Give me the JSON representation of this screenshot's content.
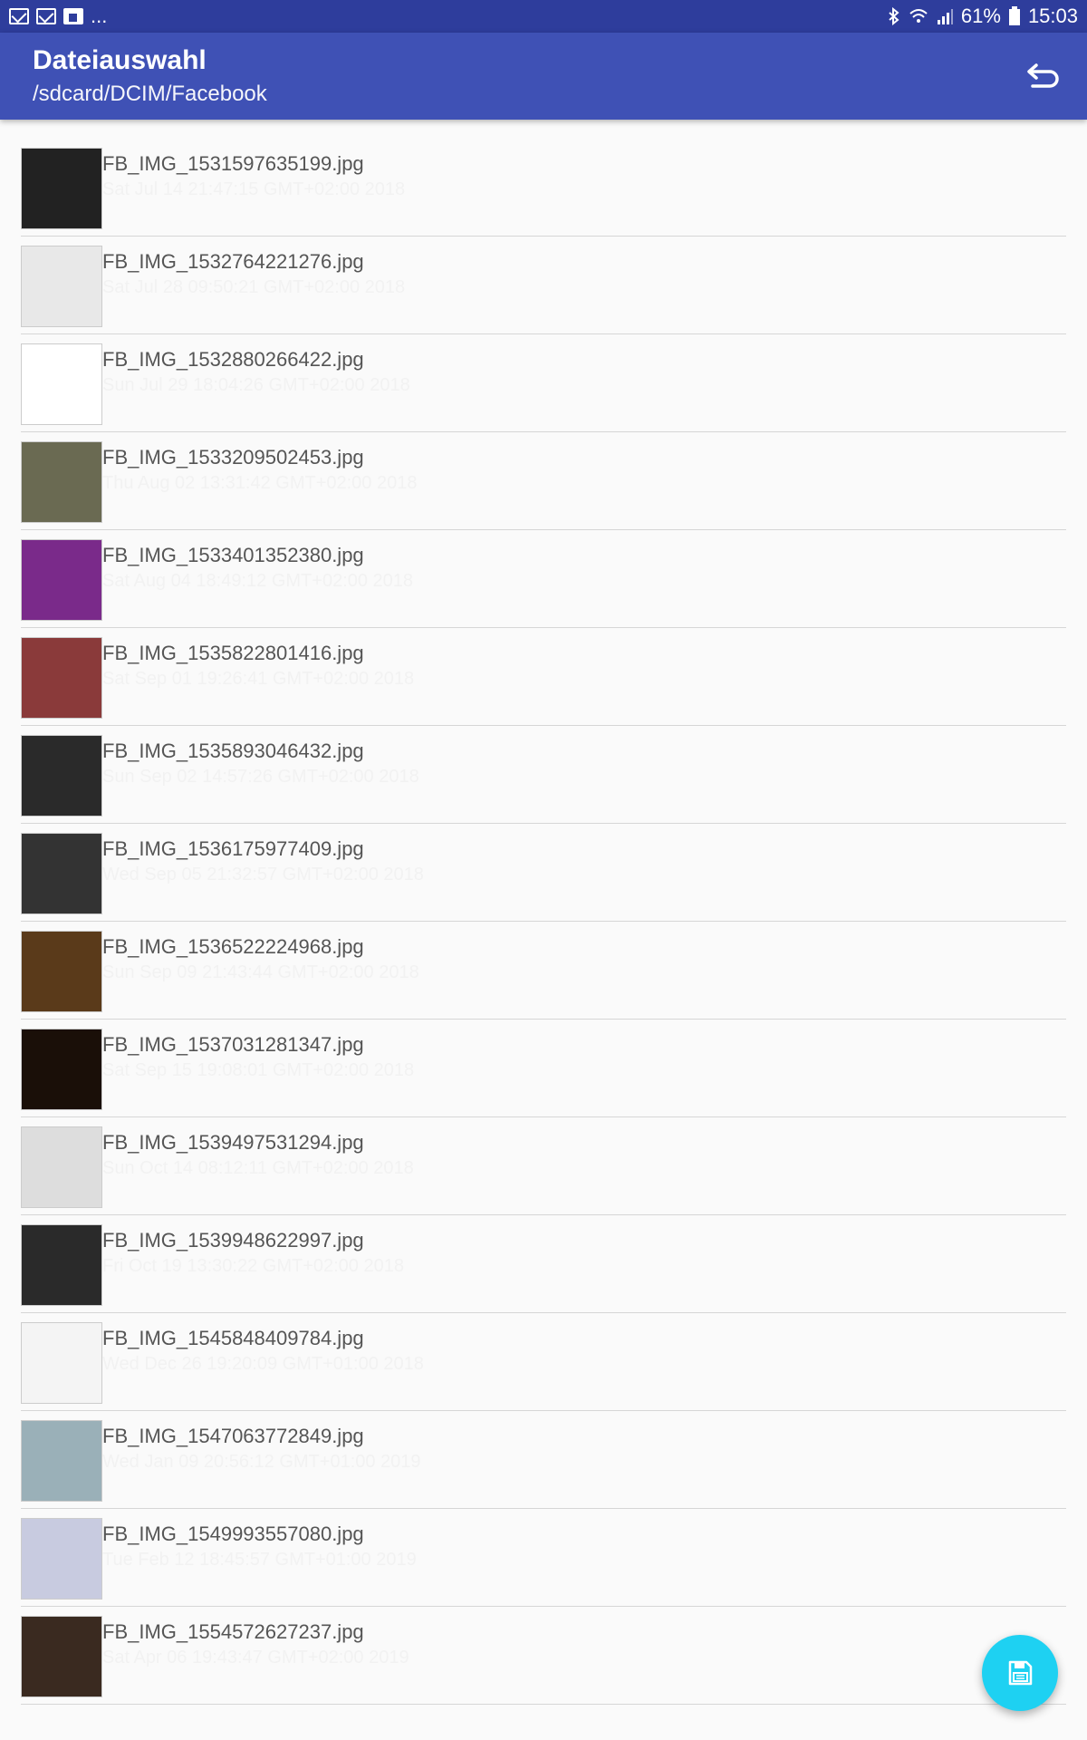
{
  "status_bar": {
    "left_extra": "...",
    "battery": "61%",
    "time": "15:03"
  },
  "app_bar": {
    "title": "Dateiauswahl",
    "path": "/sdcard/DCIM/Facebook",
    "back_icon": "undo-icon"
  },
  "files": [
    {
      "name": "FB_IMG_1531597635199.jpg",
      "date": "Sat Jul 14 21:47:15 GMT+02:00 2018",
      "thumb": "#222222"
    },
    {
      "name": "FB_IMG_1532764221276.jpg",
      "date": "Sat Jul 28 09:50:21 GMT+02:00 2018",
      "thumb": "#e8e8e8"
    },
    {
      "name": "FB_IMG_1532880266422.jpg",
      "date": "Sun Jul 29 18:04:26 GMT+02:00 2018",
      "thumb": "#ffffff"
    },
    {
      "name": "FB_IMG_1533209502453.jpg",
      "date": "Thu Aug 02 13:31:42 GMT+02:00 2018",
      "thumb": "#6a6a52"
    },
    {
      "name": "FB_IMG_1533401352380.jpg",
      "date": "Sat Aug 04 18:49:12 GMT+02:00 2018",
      "thumb": "#7a2a8a"
    },
    {
      "name": "FB_IMG_1535822801416.jpg",
      "date": "Sat Sep 01 19:26:41 GMT+02:00 2018",
      "thumb": "#8a3a3a"
    },
    {
      "name": "FB_IMG_1535893046432.jpg",
      "date": "Sun Sep 02 14:57:26 GMT+02:00 2018",
      "thumb": "#2a2a2a"
    },
    {
      "name": "FB_IMG_1536175977409.jpg",
      "date": "Wed Sep 05 21:32:57 GMT+02:00 2018",
      "thumb": "#333333"
    },
    {
      "name": "FB_IMG_1536522224968.jpg",
      "date": "Sun Sep 09 21:43:44 GMT+02:00 2018",
      "thumb": "#5a3a1a"
    },
    {
      "name": "FB_IMG_1537031281347.jpg",
      "date": "Sat Sep 15 19:08:01 GMT+02:00 2018",
      "thumb": "#1a0f08"
    },
    {
      "name": "FB_IMG_1539497531294.jpg",
      "date": "Sun Oct 14 08:12:11 GMT+02:00 2018",
      "thumb": "#dddddd"
    },
    {
      "name": "FB_IMG_1539948622997.jpg",
      "date": "Fri Oct 19 13:30:22 GMT+02:00 2018",
      "thumb": "#2a2a2a"
    },
    {
      "name": "FB_IMG_1545848409784.jpg",
      "date": "Wed Dec 26 19:20:09 GMT+01:00 2018",
      "thumb": "#f4f4f4"
    },
    {
      "name": "FB_IMG_1547063772849.jpg",
      "date": "Wed Jan 09 20:56:12 GMT+01:00 2019",
      "thumb": "#9ab0b8"
    },
    {
      "name": "FB_IMG_1549993557080.jpg",
      "date": "Tue Feb 12 18:45:57 GMT+01:00 2019",
      "thumb": "#c8cbe0"
    },
    {
      "name": "FB_IMG_1554572627237.jpg",
      "date": "Sat Apr 06 19:43:47 GMT+02:00 2019",
      "thumb": "#3a2a20"
    }
  ],
  "fab": {
    "icon": "save-icon"
  }
}
